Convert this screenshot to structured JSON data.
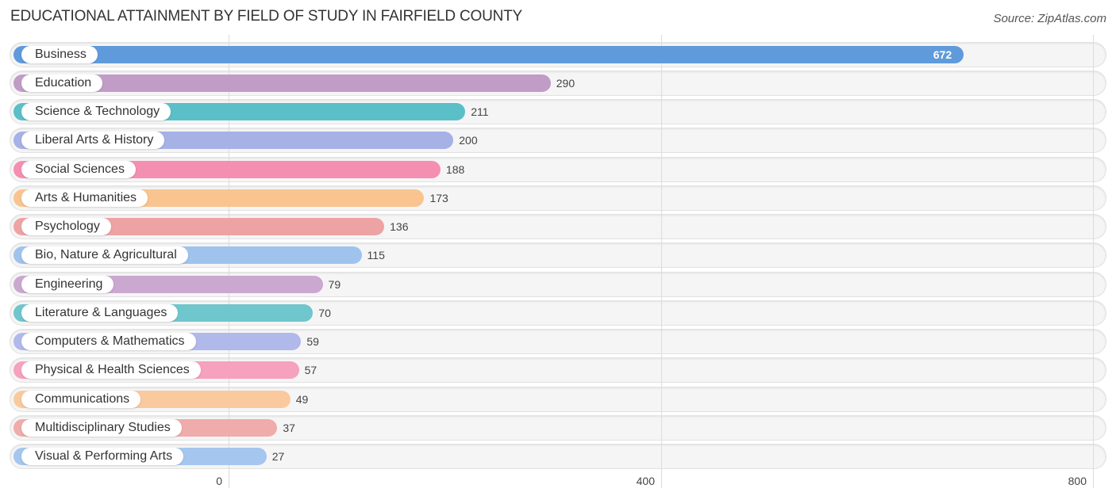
{
  "chart_data": {
    "type": "bar",
    "orientation": "horizontal",
    "title": "EDUCATIONAL ATTAINMENT BY FIELD OF STUDY IN FAIRFIELD COUNTY",
    "source": "Source: ZipAtlas.com",
    "xlabel": "",
    "ylabel": "",
    "xlim": [
      0,
      800
    ],
    "ticks": [
      0,
      400,
      800
    ],
    "tick_labels": [
      "0",
      "400",
      "800"
    ],
    "grid": true,
    "categories": [
      "Business",
      "Education",
      "Science & Technology",
      "Liberal Arts & History",
      "Social Sciences",
      "Arts & Humanities",
      "Psychology",
      "Bio, Nature & Agricultural",
      "Engineering",
      "Literature & Languages",
      "Computers & Mathematics",
      "Physical & Health Sciences",
      "Communications",
      "Multidisciplinary Studies",
      "Visual & Performing Arts"
    ],
    "values": [
      672,
      290,
      211,
      200,
      188,
      173,
      136,
      115,
      79,
      70,
      59,
      57,
      49,
      37,
      27
    ],
    "colors": [
      "#5f9bdb",
      "#c09cc7",
      "#5bbfc8",
      "#a6b1e6",
      "#f48fb1",
      "#f9c48f",
      "#eda3a3",
      "#9fc3ec",
      "#cba8cf",
      "#6fc6cc",
      "#b1b8ea",
      "#f6a1bd",
      "#fac99e",
      "#f0abab",
      "#a5c6ef"
    ]
  }
}
